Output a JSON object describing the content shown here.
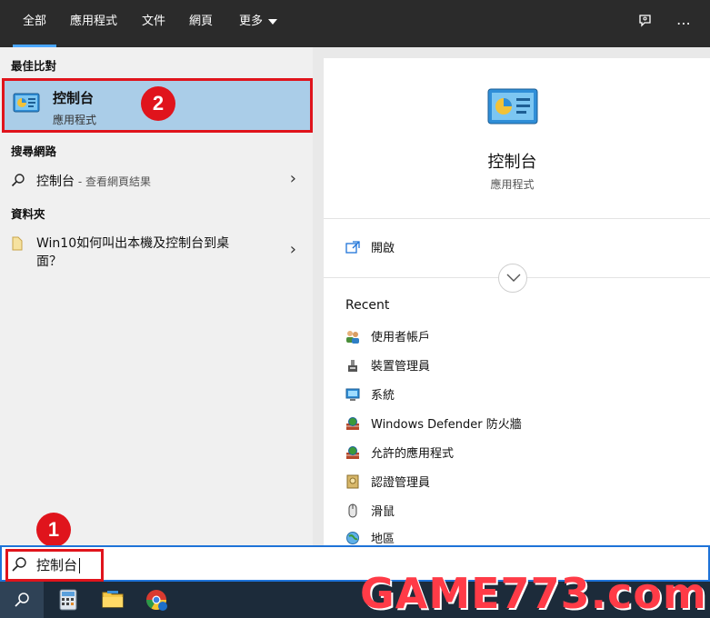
{
  "tabs": {
    "all": "全部",
    "apps": "應用程式",
    "docs": "文件",
    "web": "網頁",
    "more": "更多"
  },
  "left": {
    "best_match_header": "最佳比對",
    "best_match": {
      "title": "控制台",
      "subtitle": "應用程式"
    },
    "web_header": "搜尋網路",
    "web_result": {
      "term": "控制台",
      "suffix": " - 查看網頁結果"
    },
    "folder_header": "資料夾",
    "folder_result": "Win10如何叫出本機及控制台到桌面？"
  },
  "badges": {
    "one": "1",
    "two": "2"
  },
  "detail": {
    "title": "控制台",
    "subtitle": "應用程式",
    "open_label": "開啟",
    "recent_header": "Recent",
    "recent": [
      {
        "label": "使用者帳戶",
        "icon": "users-icon"
      },
      {
        "label": "裝置管理員",
        "icon": "device-manager-icon"
      },
      {
        "label": "系統",
        "icon": "system-icon"
      },
      {
        "label": "Windows Defender 防火牆",
        "icon": "firewall-icon"
      },
      {
        "label": "允許的應用程式",
        "icon": "firewall-icon"
      },
      {
        "label": "認證管理員",
        "icon": "credential-icon"
      },
      {
        "label": "滑鼠",
        "icon": "mouse-icon"
      },
      {
        "label": "地區",
        "icon": "region-icon"
      }
    ]
  },
  "search": {
    "value": "控制台"
  },
  "watermark": "GAME773.com",
  "colors": {
    "accent": "#4aa6ff",
    "highlight": "#aacde8",
    "annotation": "#e0141c"
  }
}
